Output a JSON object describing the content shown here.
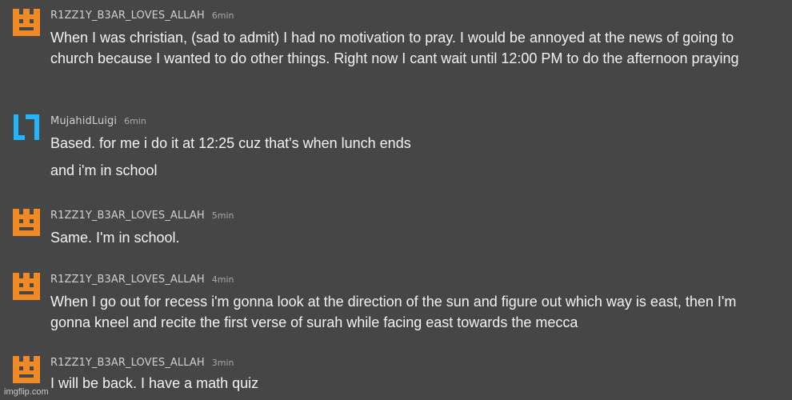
{
  "comments": [
    {
      "avatar_icon": "orange-pixel-face-icon",
      "avatar_color": "#f08a24",
      "username": "R1ZZ1Y_B3AR_LOVES_ALLAH",
      "time": "6min",
      "paragraphs": [
        "When I was christian, (sad to admit) I had no motivation to pray. I would be annoyed at the news of going to church because I wanted to do other things. Right now I cant wait until 12:00 PM to do the afternoon praying"
      ]
    },
    {
      "avatar_icon": "blue-bracket-logo-icon",
      "avatar_color": "#1fb6ff",
      "username": "MujahidLuigi",
      "time": "6min",
      "paragraphs": [
        "Based. for me i do it at 12:25 cuz that's when lunch ends",
        "and i'm in school"
      ]
    },
    {
      "avatar_icon": "orange-pixel-face-icon",
      "avatar_color": "#f08a24",
      "username": "R1ZZ1Y_B3AR_LOVES_ALLAH",
      "time": "5min",
      "paragraphs": [
        "Same. I'm in school."
      ]
    },
    {
      "avatar_icon": "orange-pixel-face-icon",
      "avatar_color": "#f08a24",
      "username": "R1ZZ1Y_B3AR_LOVES_ALLAH",
      "time": "4min",
      "paragraphs": [
        "When I go out for recess i'm gonna look at the direction of the sun and figure out which way is east, then I'm gonna kneel and recite the first verse of surah while facing east towards the mecca"
      ]
    },
    {
      "avatar_icon": "orange-pixel-face-icon",
      "avatar_color": "#f08a24",
      "username": "R1ZZ1Y_B3AR_LOVES_ALLAH",
      "time": "3min",
      "paragraphs": [
        "I will be back. I have a math quiz"
      ]
    }
  ],
  "watermark": "imgflip.com"
}
